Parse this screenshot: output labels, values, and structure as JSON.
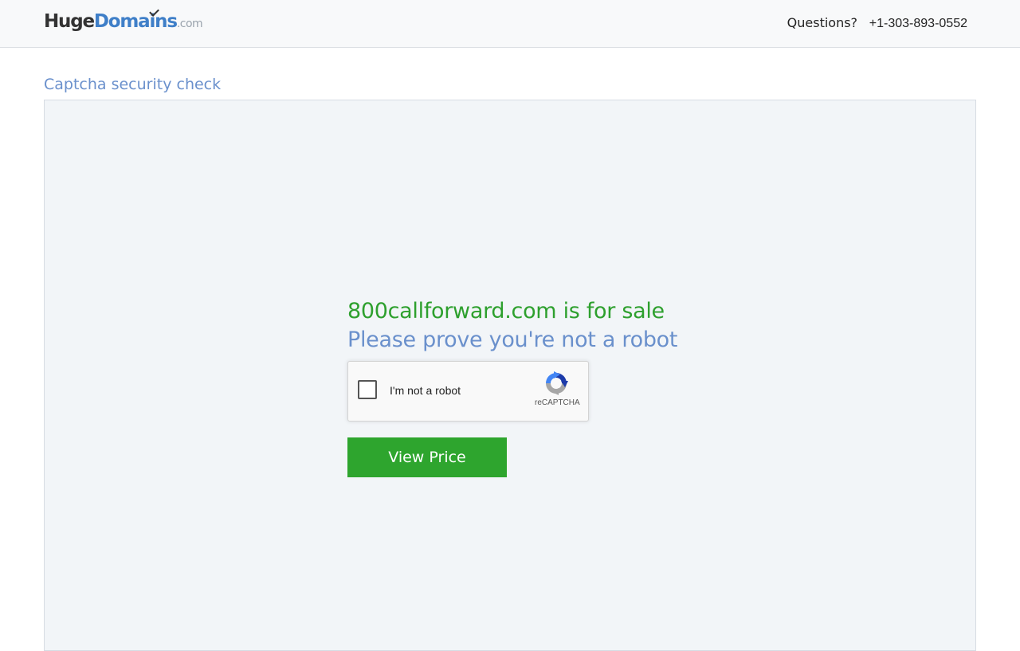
{
  "header": {
    "logo": {
      "part_huge": "Huge",
      "part_domains": "Domains",
      "part_com": ".com"
    },
    "questions_label": "Questions?",
    "phone": "+1-303-893-0552"
  },
  "page_title": "Captcha security check",
  "main": {
    "sale_heading": "800callforward.com is for sale",
    "robot_heading": "Please prove you're not a robot",
    "recaptcha": {
      "checkbox_label": "I'm not a robot",
      "brand": "reCAPTCHA",
      "icon": "recaptcha-logo-icon"
    },
    "view_price_button": "View Price"
  },
  "colors": {
    "brand_blue": "#3f7fc8",
    "accent_green": "#2ea52e",
    "heading_blue": "#6a90cc",
    "panel_bg": "#f2f5f8"
  }
}
